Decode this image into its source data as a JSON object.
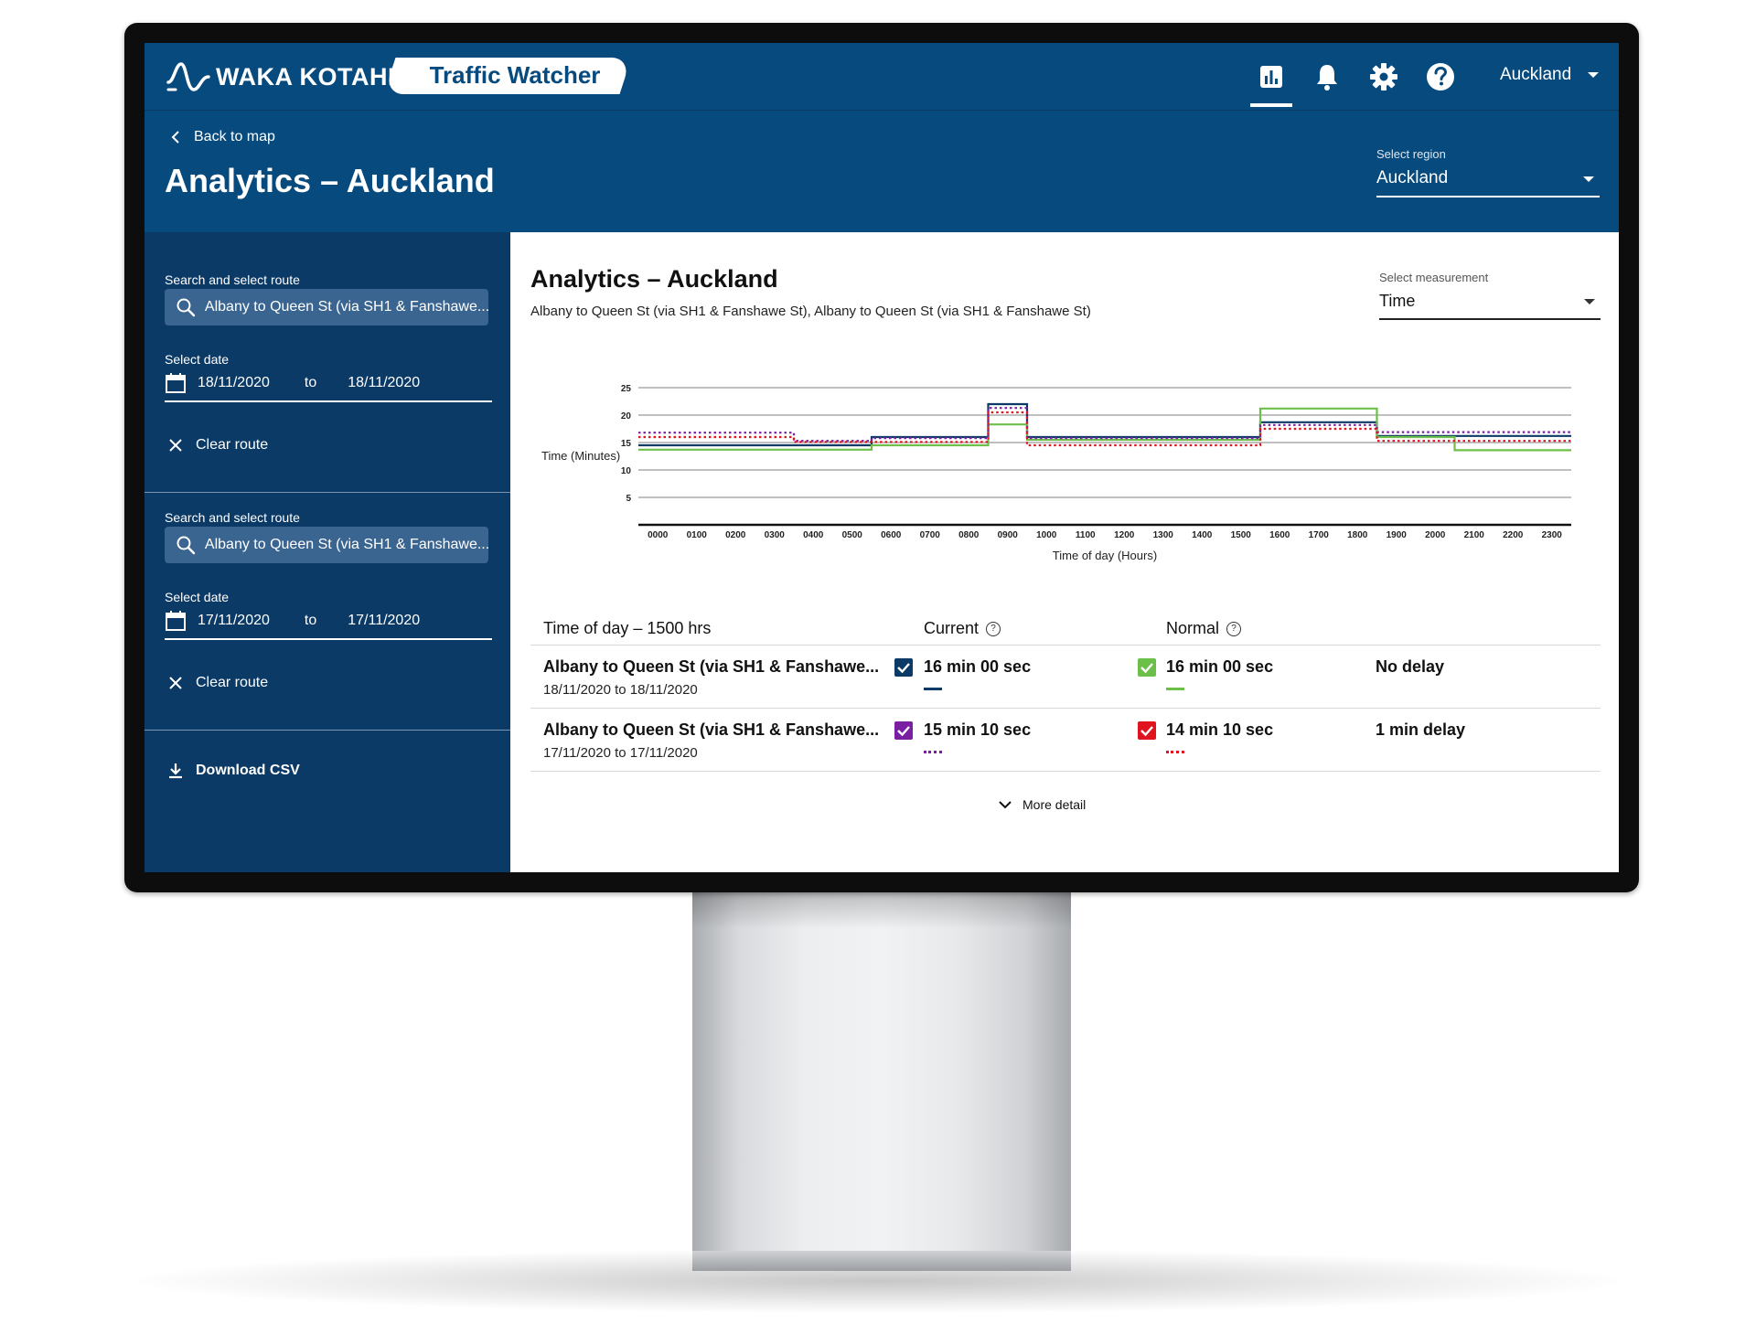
{
  "app": {
    "brand": "WAKA KOTAHI",
    "product": "Traffic Watcher",
    "region_menu": "Auckland",
    "nav_icons": [
      "analytics-icon",
      "bell-icon",
      "gear-icon",
      "help-icon"
    ]
  },
  "header": {
    "back_label": "Back to map",
    "title": "Analytics – Auckland",
    "region_select_label": "Select region",
    "region_select_value": "Auckland"
  },
  "sidebar": {
    "routes": [
      {
        "search_label": "Search and select route",
        "search_value": "Albany to Queen St (via SH1 & Fanshawe...",
        "date_label": "Select date",
        "date_from": "18/11/2020",
        "date_sep": "to",
        "date_to": "18/11/2020",
        "clear_label": "Clear route"
      },
      {
        "search_label": "Search and select route",
        "search_value": "Albany to Queen St (via SH1 & Fanshawe...",
        "date_label": "Select date",
        "date_from": "17/11/2020",
        "date_sep": "to",
        "date_to": "17/11/2020",
        "clear_label": "Clear route"
      }
    ],
    "download_label": "Download CSV"
  },
  "main": {
    "title": "Analytics – Auckland",
    "subtitle": "Albany to Queen St (via SH1 & Fanshawe St), Albany to Queen St (via SH1 & Fanshawe St)",
    "measure_label": "Select measurement",
    "measure_value": "Time",
    "table": {
      "col_time": "Time of day – 1500 hrs",
      "col_current": "Current",
      "col_normal": "Normal",
      "rows": [
        {
          "route": "Albany to Queen St (via SH1 & Fanshawe...",
          "dates": "18/11/2020 to 18/11/2020",
          "current": "16 min 00 sec",
          "normal": "16 min 00 sec",
          "delay": "No delay",
          "current_color": "#0b3a66",
          "normal_color": "#6cc04a",
          "current_style": "solid",
          "normal_style": "solid"
        },
        {
          "route": "Albany to Queen St (via SH1 & Fanshawe...",
          "dates": "17/11/2020 to 17/11/2020",
          "current": "15 min 10 sec",
          "normal": "14 min 10 sec",
          "delay": "1 min delay",
          "current_color": "#7b1fa2",
          "normal_color": "#e0141e",
          "current_style": "dotted",
          "normal_style": "dotted"
        }
      ]
    },
    "more_detail": "More detail"
  },
  "chart_data": {
    "type": "line",
    "xlabel": "Time of day (Hours)",
    "ylabel": "Time (Minutes)",
    "ylim": [
      0,
      25
    ],
    "yticks": [
      5,
      10,
      15,
      20,
      25
    ],
    "grid": true,
    "step": true,
    "categories": [
      "0000",
      "0100",
      "0200",
      "0300",
      "0400",
      "0500",
      "0600",
      "0700",
      "0800",
      "0900",
      "1000",
      "1100",
      "1200",
      "1300",
      "1400",
      "1500",
      "1600",
      "1700",
      "1800",
      "1900",
      "2000",
      "2100",
      "2200",
      "2300"
    ],
    "series": [
      {
        "color": "#0b3a66",
        "style": "solid",
        "values": [
          14.5,
          14.5,
          14.5,
          14.5,
          14.5,
          14.5,
          16,
          16,
          16,
          22,
          16,
          16,
          16,
          16,
          16,
          16,
          18.7,
          18.7,
          18.7,
          16.2,
          16.2,
          16.2,
          16.2,
          16.2
        ]
      },
      {
        "color": "#6cc04a",
        "style": "solid",
        "values": [
          13.7,
          13.7,
          13.7,
          13.7,
          13.7,
          13.7,
          14.5,
          14.5,
          14.5,
          18.3,
          15.5,
          15.5,
          15.5,
          15.5,
          15.5,
          15.5,
          21.2,
          21.2,
          21.2,
          16,
          16,
          13.6,
          13.6,
          13.6
        ]
      },
      {
        "color": "#7b1fa2",
        "style": "dotted",
        "values": [
          16.8,
          16.8,
          16.8,
          16.8,
          15.3,
          15.3,
          15.8,
          15.8,
          15.8,
          21.3,
          15.8,
          15.8,
          15.8,
          15.8,
          15.8,
          15.8,
          18.2,
          18.2,
          18.2,
          16.9,
          16.9,
          16.9,
          16.9,
          16.9
        ]
      },
      {
        "color": "#e0141e",
        "style": "dotted",
        "values": [
          16,
          16,
          16,
          16,
          15.1,
          15.1,
          15.1,
          15.1,
          15.1,
          20.5,
          14.5,
          14.5,
          14.5,
          14.5,
          14.5,
          14.5,
          17.5,
          17.5,
          17.5,
          15.3,
          15.3,
          15.3,
          15.3,
          15.3
        ]
      }
    ]
  }
}
